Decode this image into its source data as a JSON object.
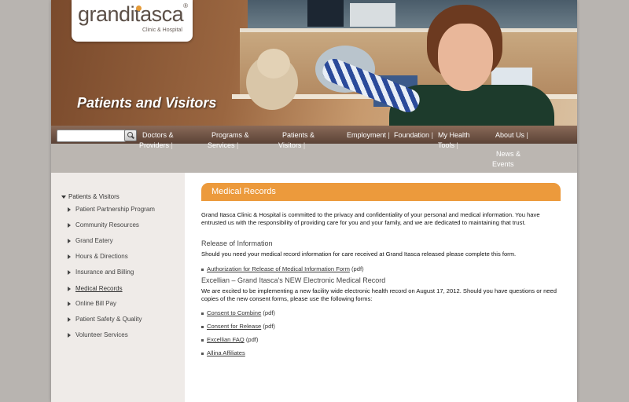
{
  "logo": {
    "word_part1": "grand",
    "word_part2": "itasca",
    "registered": "®",
    "subtitle": "Clinic & Hospital"
  },
  "banner": {
    "title": "Patients and Visitors"
  },
  "search": {
    "placeholder": "",
    "button_icon": "search-icon"
  },
  "nav": {
    "items": [
      {
        "line1": "Doctors &",
        "line2": "Providers",
        "sep": "|"
      },
      {
        "line1": "Programs &",
        "line2": "Services",
        "sep": "|"
      },
      {
        "line1": "Patients &",
        "line2": "Visitors",
        "sep": "|"
      },
      {
        "line1": "Employment",
        "sep": "|"
      },
      {
        "line1": "Foundation",
        "sep": "|"
      },
      {
        "line1": "My Health",
        "line2": "Tools",
        "sep": "|"
      },
      {
        "line1": "About Us",
        "sep": "|"
      },
      {
        "line1": "News &",
        "line2": "Events"
      }
    ]
  },
  "sidebar": {
    "heading": "Patients & Visitors",
    "items": [
      {
        "label": "Patient Partnership Program"
      },
      {
        "label": "Community Resources"
      },
      {
        "label": "Grand Eatery"
      },
      {
        "label": "Hours & Directions"
      },
      {
        "label": "Insurance and Billing"
      },
      {
        "label": "Medical Records"
      },
      {
        "label": "Online Bill Pay"
      },
      {
        "label": "Patient Safety & Quality"
      },
      {
        "label": "Volunteer Services"
      }
    ]
  },
  "main": {
    "title": "Medical Records",
    "intro": "Grand Itasca Clinic & Hospital is committed to the privacy and confidentiality of your personal and medical information. You have entrusted us with the responsibility of providing care for you and your family, and we are dedicated to maintaining that trust.",
    "section1": {
      "heading": "Release of Information",
      "text": "Should you need your medical record information for care received at Grand Itasca released please complete this form.",
      "links": [
        {
          "label": "Authorization for Release of Medical Information Form",
          "suffix": " (pdf)"
        }
      ]
    },
    "section2": {
      "heading": "Excellian – Grand Itasca's NEW Electronic Medical Record",
      "text": "We are excited to be implementing a new facility wide electronic health record on August 17, 2012. Should you have questions or need copies of the new consent forms, please use the following forms:",
      "links": [
        {
          "label": "Consent to Combine",
          "suffix": " (pdf)"
        },
        {
          "label": "Consent for Release",
          "suffix": " (pdf)"
        },
        {
          "label": "Excellian FAQ",
          "suffix": " (pdf)"
        },
        {
          "label": "Allina Affiliates",
          "suffix": ""
        }
      ]
    }
  },
  "colors": {
    "accent_orange": "#ec9a3c",
    "nav_brown": "#5a4236",
    "sidebar_bg": "#efebe8",
    "page_bg": "#b8b4b0"
  }
}
